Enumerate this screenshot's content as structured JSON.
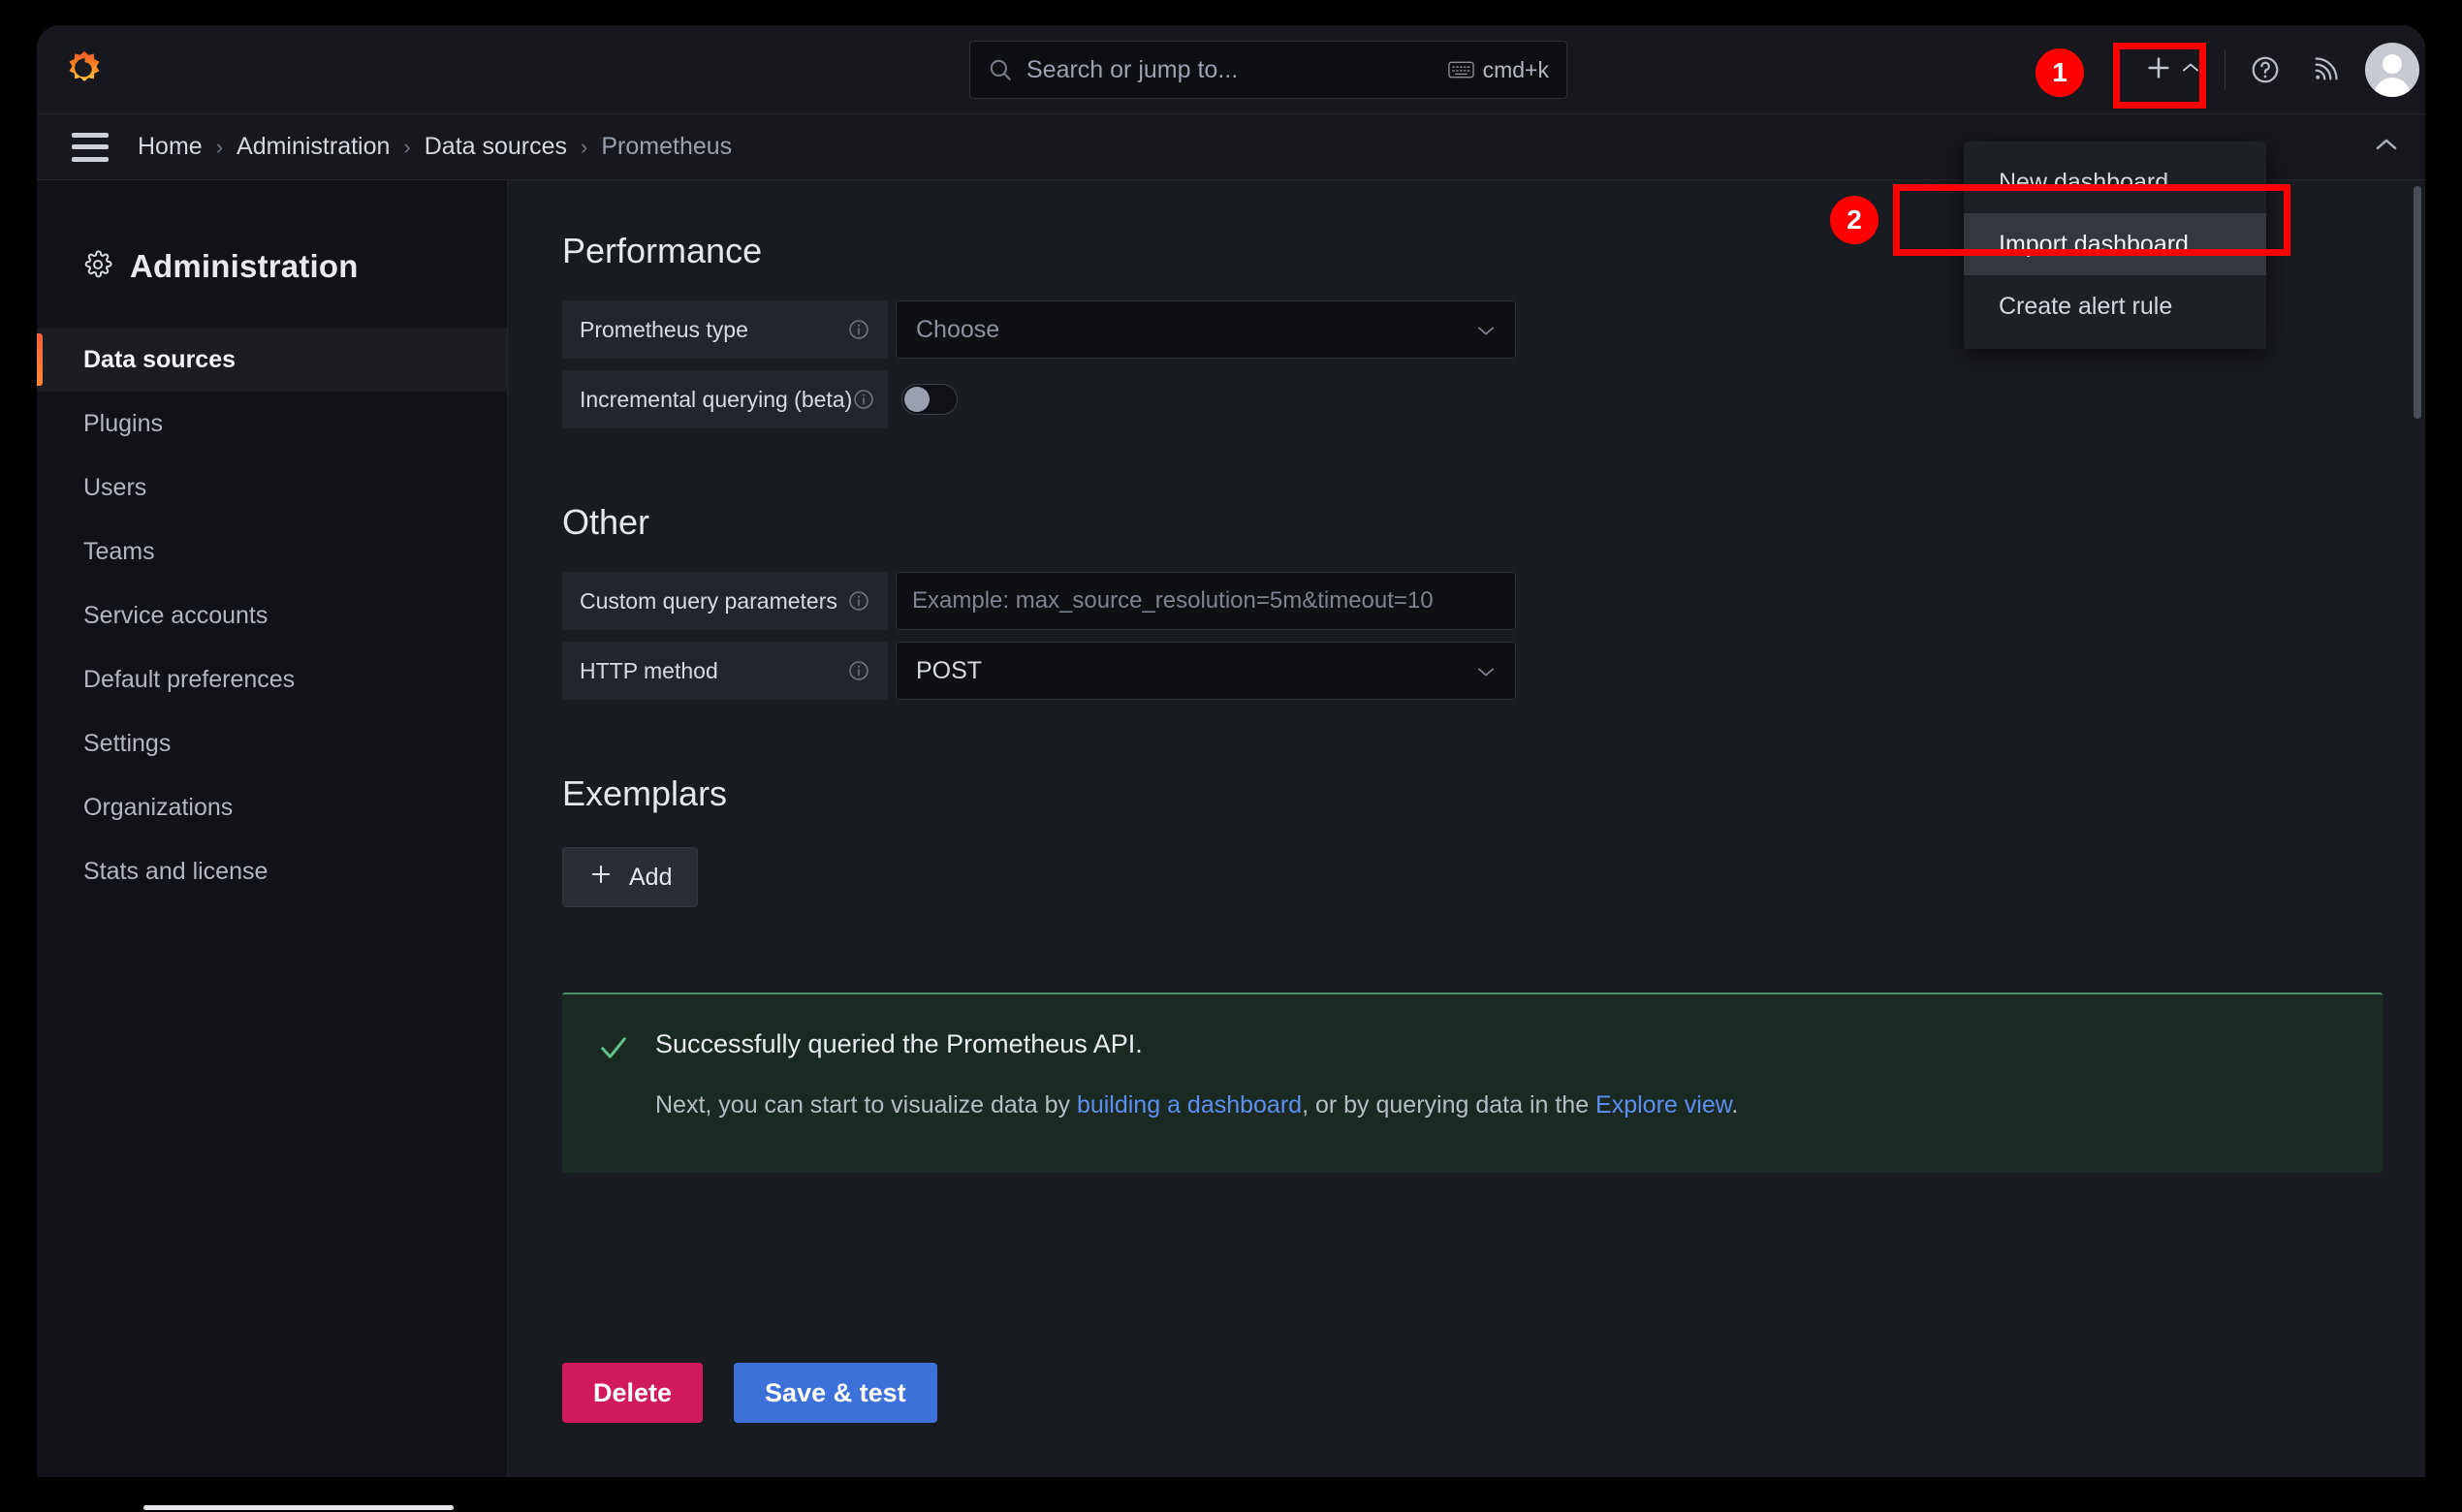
{
  "app": {
    "logo_icon": "grafana-logo-icon",
    "accent_orange": "#f55f3e"
  },
  "topbar": {
    "search": {
      "icon": "search-icon",
      "placeholder": "Search or jump to...",
      "shortcut_icon": "keyboard-icon",
      "shortcut_label": "cmd+k"
    },
    "new_button": {
      "icon": "plus-icon",
      "chevron": "chevron-up-icon"
    },
    "help_icon": "help-circle-icon",
    "news_icon": "rss-icon",
    "avatar": "user-avatar"
  },
  "breadcrumb": {
    "menu_icon": "hamburger-menu-icon",
    "items": [
      {
        "label": "Home"
      },
      {
        "label": "Administration"
      },
      {
        "label": "Data sources"
      },
      {
        "label": "Prometheus"
      }
    ],
    "separator": "›",
    "collapse_icon": "chevron-up-icon"
  },
  "new_menu": {
    "items": [
      {
        "label": "New dashboard",
        "highlighted": false
      },
      {
        "label": "Import dashboard",
        "highlighted": true
      },
      {
        "label": "Create alert rule",
        "highlighted": false
      }
    ]
  },
  "annotations": {
    "step1": "1",
    "step2": "2",
    "color": "#ff0000"
  },
  "sidebar": {
    "icon": "gear-icon",
    "title": "Administration",
    "items": [
      {
        "label": "Data sources",
        "active": true
      },
      {
        "label": "Plugins",
        "active": false
      },
      {
        "label": "Users",
        "active": false
      },
      {
        "label": "Teams",
        "active": false
      },
      {
        "label": "Service accounts",
        "active": false
      },
      {
        "label": "Default preferences",
        "active": false
      },
      {
        "label": "Settings",
        "active": false
      },
      {
        "label": "Organizations",
        "active": false
      },
      {
        "label": "Stats and license",
        "active": false
      }
    ]
  },
  "main": {
    "performance": {
      "heading": "Performance",
      "prometheus_type": {
        "label": "Prometheus type",
        "info_icon": "info-circle-icon",
        "value": "Choose",
        "is_placeholder": true,
        "chevron": "chevron-down-icon"
      },
      "incremental_querying": {
        "label": "Incremental querying (beta)",
        "info_icon": "info-circle-icon",
        "toggle_on": false
      }
    },
    "other": {
      "heading": "Other",
      "custom_query_parameters": {
        "label": "Custom query parameters",
        "info_icon": "info-circle-icon",
        "value": "",
        "placeholder": "Example: max_source_resolution=5m&timeout=10"
      },
      "http_method": {
        "label": "HTTP method",
        "info_icon": "info-circle-icon",
        "value": "POST",
        "chevron": "chevron-down-icon"
      }
    },
    "exemplars": {
      "heading": "Exemplars",
      "add_button": {
        "icon": "plus-icon",
        "label": "Add"
      }
    },
    "alert": {
      "icon": "check-icon",
      "title": "Successfully queried the Prometheus API.",
      "desc_before": "Next, you can start to visualize data by ",
      "link1": "building a dashboard",
      "desc_middle": ", or by querying data in the ",
      "link2": "Explore view",
      "desc_after": ".",
      "accent": "#4e8c6a"
    },
    "actions": {
      "delete_label": "Delete",
      "delete_color": "#d01a5b",
      "save_label": "Save & test",
      "save_color": "#3d71d9"
    }
  }
}
